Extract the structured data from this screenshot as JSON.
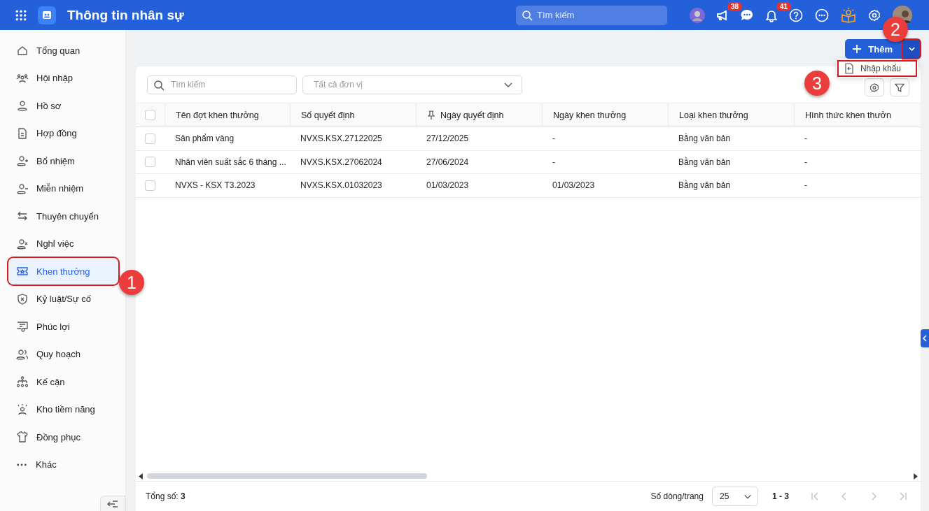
{
  "topbar": {
    "title": "Thông tin nhân sự",
    "search": {
      "placeholder": "Tìm kiếm"
    },
    "badges": [
      "38",
      "41"
    ]
  },
  "sidebar": {
    "items": [
      {
        "label": "Tổng quan",
        "selected": false,
        "highlighted": false
      },
      {
        "label": "Hội nhập",
        "selected": false,
        "highlighted": false
      },
      {
        "label": "Hồ sơ",
        "selected": false,
        "highlighted": false
      },
      {
        "label": "Hợp đồng",
        "selected": false,
        "highlighted": false
      },
      {
        "label": "Bổ nhiệm",
        "selected": false,
        "highlighted": false
      },
      {
        "label": "Miễn nhiệm",
        "selected": false,
        "highlighted": false
      },
      {
        "label": "Thuyên chuyển",
        "selected": false,
        "highlighted": false
      },
      {
        "label": "Nghỉ việc",
        "selected": false,
        "highlighted": false
      },
      {
        "label": "Khen thưởng",
        "selected": true,
        "highlighted": true,
        "callout": "1"
      },
      {
        "label": "Kỷ luật/Sự cố",
        "selected": false,
        "highlighted": false
      },
      {
        "label": "Phúc lợi",
        "selected": false,
        "highlighted": false
      },
      {
        "label": "Quy hoạch",
        "selected": false,
        "highlighted": false
      },
      {
        "label": "Kế cận",
        "selected": false,
        "highlighted": false
      },
      {
        "label": "Kho tiềm năng",
        "selected": false,
        "highlighted": false
      },
      {
        "label": "Đồng phục",
        "selected": false,
        "highlighted": false
      },
      {
        "label": "Khác",
        "selected": false,
        "highlighted": false
      }
    ]
  },
  "toolbar": {
    "add_button": "Thêm",
    "dropdown": {
      "highlighted": true,
      "callout": "2"
    },
    "menu": [
      {
        "label": "Nhập khẩu",
        "highlighted": true,
        "callout": "3"
      }
    ]
  },
  "filters": {
    "search": {
      "placeholder": "Tìm kiếm"
    },
    "unit_select": {
      "placeholder": "Tất cả đơn vị"
    }
  },
  "table": {
    "all_checked": false,
    "columns": [
      {
        "label": "Tên đợt khen thưởng",
        "pinned": false
      },
      {
        "label": "Số quyết định",
        "pinned": false
      },
      {
        "label": "Ngày quyết định",
        "pinned": true
      },
      {
        "label": "Ngày khen thưởng",
        "pinned": false
      },
      {
        "label": "Loại khen thưởng",
        "pinned": false
      },
      {
        "label": "Hình thức khen thưởn",
        "pinned": false
      }
    ],
    "rows": [
      {
        "checked": false,
        "cells": [
          "Sản phẩm vàng",
          "NVXS.KSX.27122025",
          "27/12/2025",
          "-",
          "Bằng văn bản",
          "-"
        ]
      },
      {
        "checked": false,
        "cells": [
          "Nhân viên suất sắc 6 tháng ...",
          "NVXS.KSX.27062024",
          "27/06/2024",
          "-",
          "Bằng văn bản",
          "-"
        ]
      },
      {
        "checked": false,
        "cells": [
          "NVXS - KSX T3.2023",
          "NVXS.KSX.01032023",
          "01/03/2023",
          "01/03/2023",
          "Bằng văn bản",
          "-"
        ]
      }
    ]
  },
  "footer": {
    "total": "Tổng số: **3**",
    "rows_per_page_label": "Số dòng/trang",
    "rows_per_page": "25",
    "range": "1 - 3"
  }
}
